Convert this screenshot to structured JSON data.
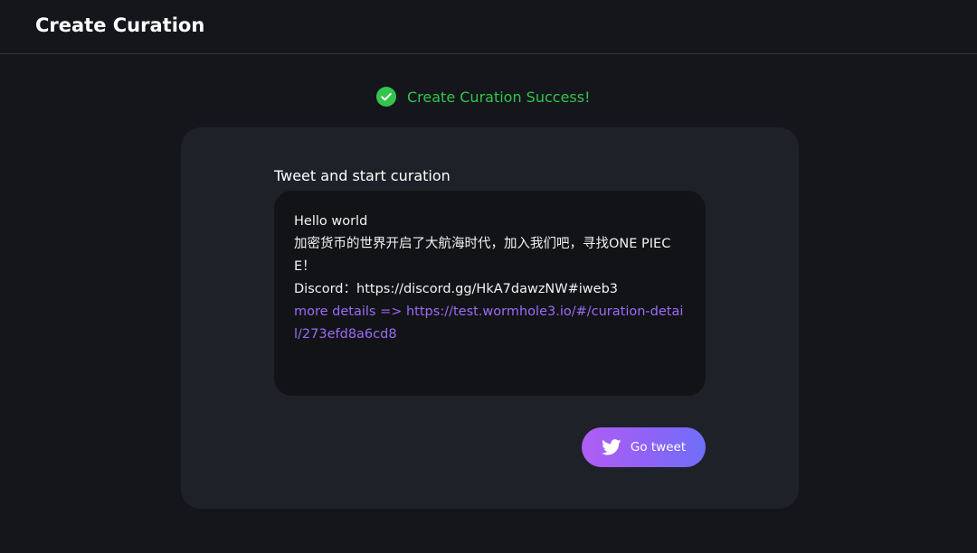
{
  "header": {
    "title": "Create Curation"
  },
  "status": {
    "icon": "check-circle-icon",
    "text": "Create Curation Success!",
    "color": "#33c44d"
  },
  "card": {
    "heading": "Tweet and start curation",
    "tweet": {
      "line1": "Hello world",
      "line2": "加密货币的世界开启了大航海时代，加入我们吧，寻找ONE PIECE！",
      "line3": "Discord：https://discord.gg/HkA7dawzNW#iweb3",
      "link": "more details => https://test.wormhole3.io/#/curation-detail/273efd8a6cd8"
    },
    "button": {
      "icon": "twitter-icon",
      "label": "Go tweet"
    }
  },
  "colors": {
    "background": "#14161b",
    "card": "#1e2128",
    "tweet_box": "#121316",
    "link": "#9b6bf7",
    "button_gradient_start": "#b05df5",
    "button_gradient_end": "#6f6ff8"
  }
}
